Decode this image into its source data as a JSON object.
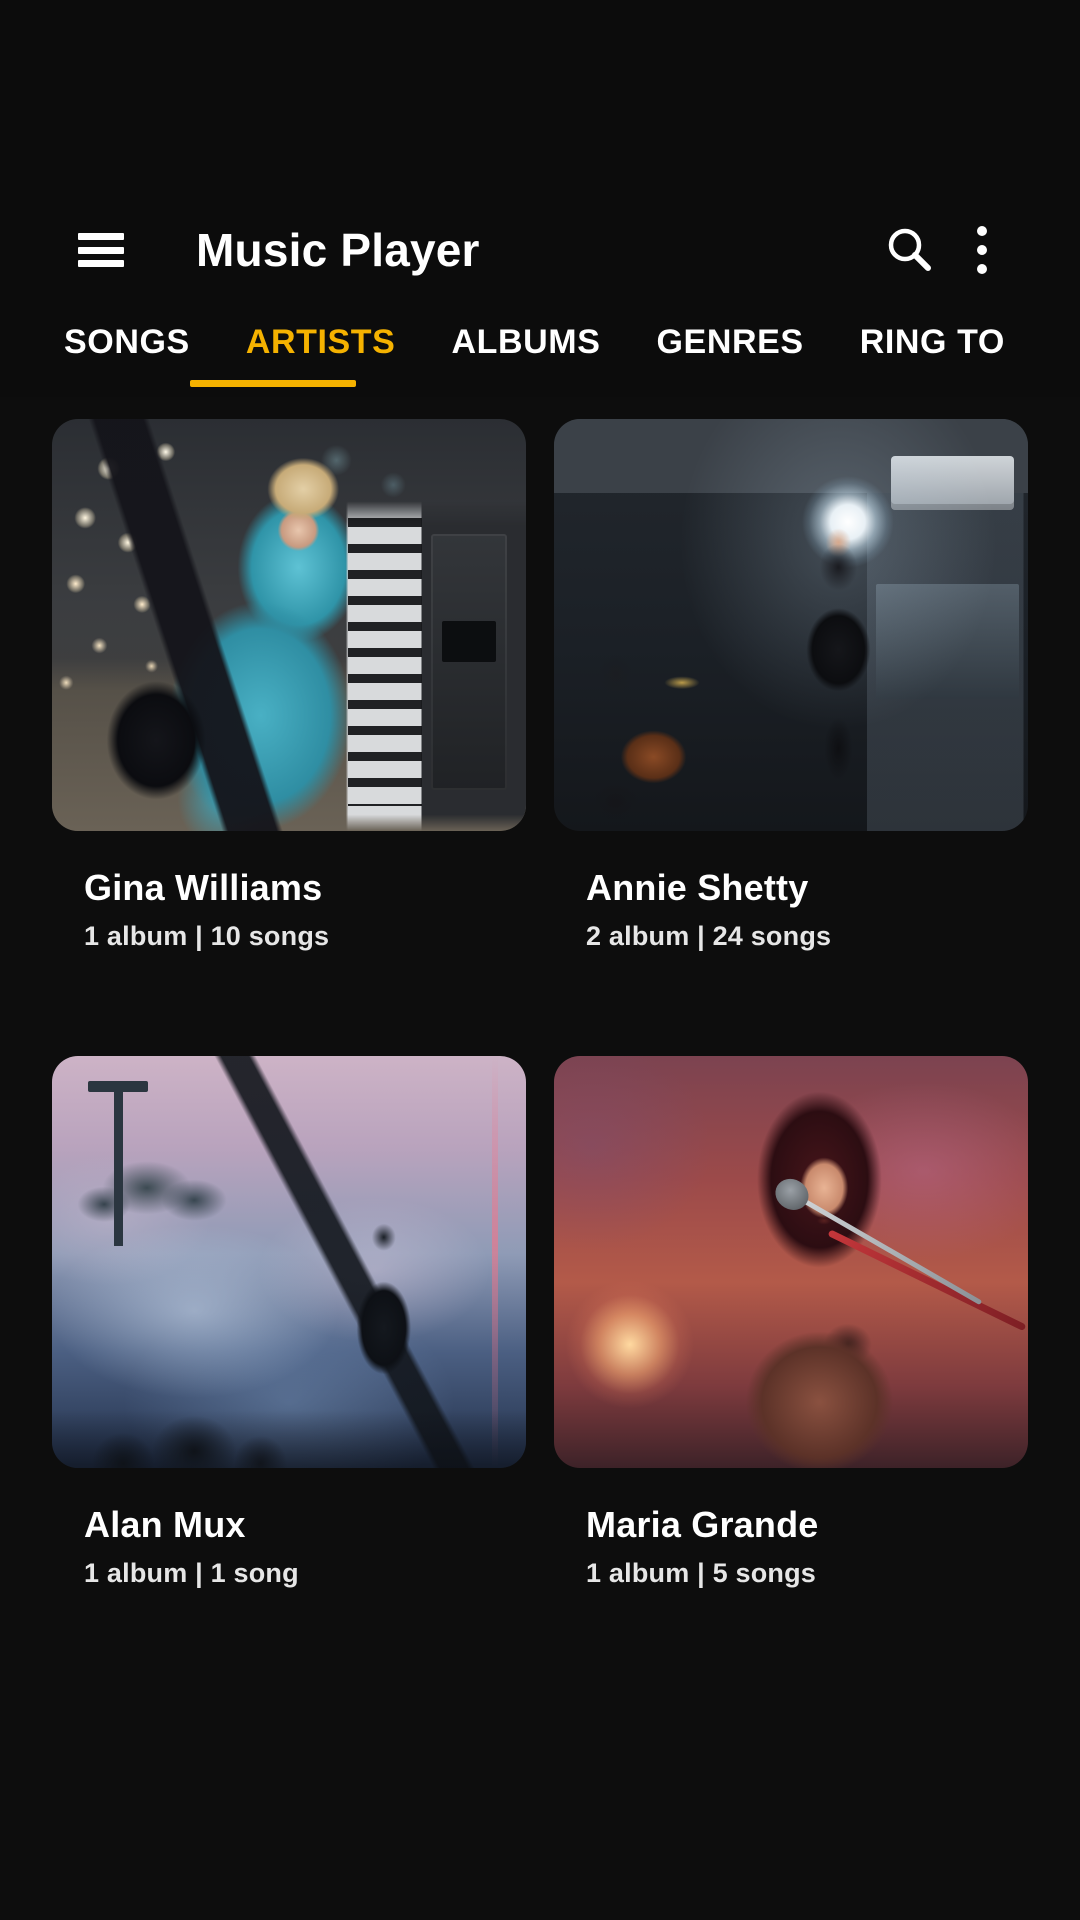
{
  "app": {
    "title": "Music Player"
  },
  "toolbar": {
    "menu_icon": "hamburger-menu-icon",
    "search_icon": "search-icon",
    "overflow_icon": "more-vertical-icon"
  },
  "tabs": {
    "active_index": 1,
    "active_color": "#f5b200",
    "items": [
      {
        "label": "SONGS"
      },
      {
        "label": "ARTISTS"
      },
      {
        "label": "ALBUMS"
      },
      {
        "label": "GENRES"
      },
      {
        "label": "RING TO"
      }
    ]
  },
  "artists": [
    {
      "name": "Gina Williams",
      "meta": "1 album | 10 songs",
      "artwork": "woman-in-teal-dress-with-guitar-and-keyboard"
    },
    {
      "name": "Annie Shetty",
      "meta": "2 album | 24 songs",
      "artwork": "singer-on-stage-with-drummer-and-spotlight"
    },
    {
      "name": "Alan Mux",
      "meta": "1 album | 1 song",
      "artwork": "singer-in-pink-smoke-at-outdoor-concert"
    },
    {
      "name": "Maria Grande",
      "meta": "1 album | 5 songs",
      "artwork": "female-singer-closeup-with-microphone-red-light"
    }
  ],
  "theme": {
    "background": "#0d0d0d",
    "toolbar_background": "#0c0c0c",
    "text_primary": "#ffffff",
    "text_secondary": "#e6e6e6",
    "accent": "#f5b200"
  }
}
